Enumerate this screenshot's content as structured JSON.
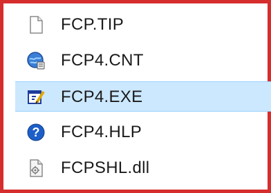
{
  "file_list": {
    "items": [
      {
        "name": "FCP.TIP",
        "icon": "text-file-icon",
        "selected": false
      },
      {
        "name": "FCP4.CNT",
        "icon": "help-contents-icon",
        "selected": false
      },
      {
        "name": "FCP4.EXE",
        "icon": "application-icon",
        "selected": true
      },
      {
        "name": "FCP4.HLP",
        "icon": "help-question-icon",
        "selected": false
      },
      {
        "name": "FCPSHL.dll",
        "icon": "dll-file-icon",
        "selected": false
      }
    ]
  },
  "colors": {
    "frame_border": "#d62d2d",
    "selection_background": "#cce8ff",
    "selection_border": "#99d1ff",
    "text": "#1a1a1a",
    "help_blue": "#1d5fc8"
  }
}
